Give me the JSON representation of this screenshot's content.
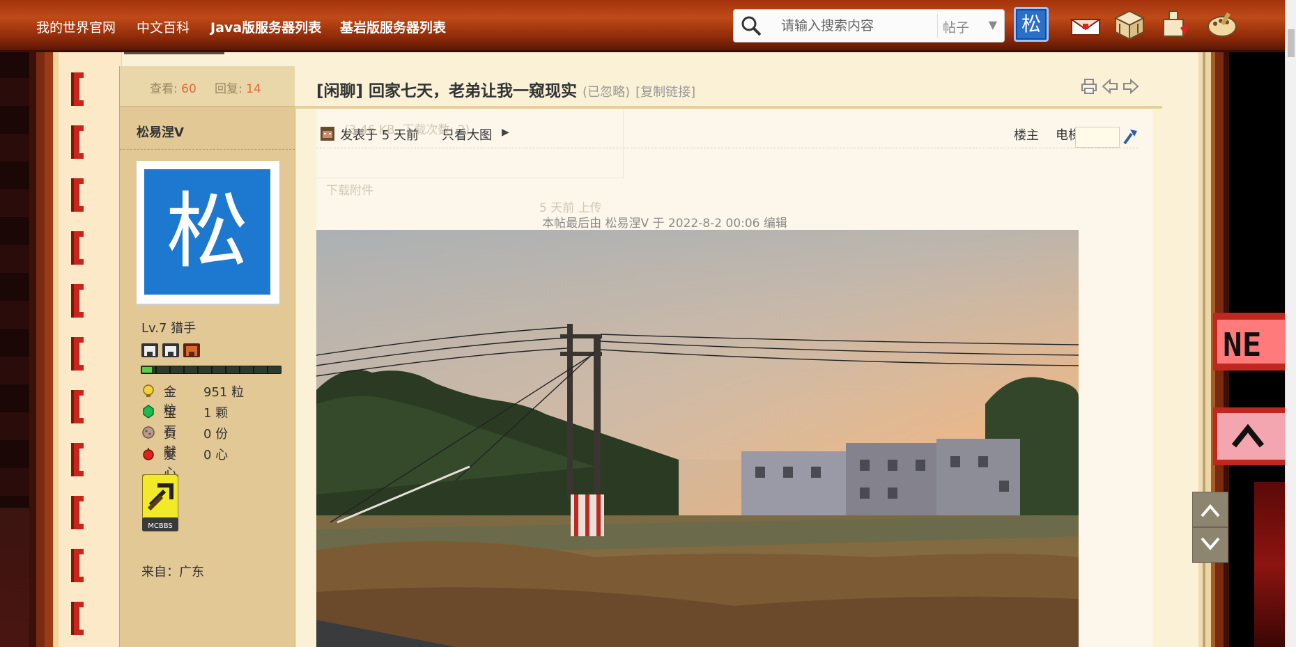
{
  "nav": {
    "links": [
      "我的世界官网",
      "中文百科",
      "Java版服务器列表",
      "基岩版服务器列表"
    ],
    "search_placeholder": "请输入搜索内容",
    "search_type": "帖子",
    "user_initial": "松"
  },
  "thread": {
    "title": "[闲聊] 回家七天，老弟让我一窥现实",
    "ignored": "(已忽略)",
    "copy_link": "[复制链接]",
    "views_label": "查看:",
    "views": "60",
    "replies_label": "回复:",
    "replies": "14"
  },
  "author": {
    "name": "松易涅V",
    "avatar_char": "松",
    "level": "Lv.7 猎手",
    "stats": [
      {
        "icon": "gold-nugget-icon",
        "label": "金粒",
        "value": "951 粒"
      },
      {
        "icon": "emerald-icon",
        "label": "宝石",
        "value": "1 颗"
      },
      {
        "icon": "contribution-icon",
        "label": "贡献",
        "value": "0 份"
      },
      {
        "icon": "apple-icon",
        "label": "爱心",
        "value": "0 心"
      }
    ],
    "medal_label": "MCBBS",
    "from": "来自：广东"
  },
  "post": {
    "posted": "发表于 5 天前",
    "only_big_image": "只看大图",
    "owner": "楼主",
    "elevator": "电梯直达",
    "edit_note": "本帖最后由 松易涅V 于 2022-8-2 00:06 编辑",
    "faint_attachment_info": "(3.46 KB, 下载次数: 2)",
    "faint_download": "下载附件",
    "faint_uploaded": "5 天前 上传"
  },
  "sidebar": {
    "badge_top": "NE"
  }
}
